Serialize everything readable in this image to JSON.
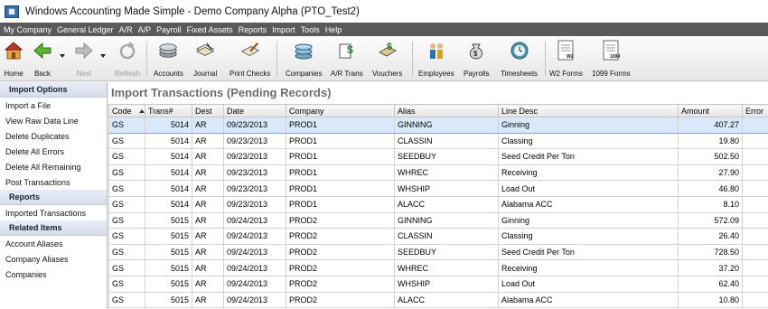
{
  "window": {
    "title": "Windows Accounting Made Simple - Demo Company Alpha (PTO_Test2)"
  },
  "menu": [
    "My Company",
    "General Ledger",
    "A/R",
    "A/P",
    "Payroll",
    "Fixed Assets",
    "Reports",
    "Import",
    "Tools",
    "Help"
  ],
  "toolbar": {
    "home": "Home",
    "back": "Back",
    "next": "Next",
    "refresh": "Refresh",
    "accounts": "Accounts",
    "journal": "Journal",
    "print_checks": "Print Checks",
    "companies": "Companies",
    "ar_trans": "A/R Trans",
    "vouchers": "Vouchers",
    "employees": "Employees",
    "payrolls": "Payrolls",
    "timesheets": "Timesheets",
    "w2_forms": "W2 Forms",
    "forms_1099": "1099 Forms",
    "w2_icon_text": "W2",
    "icon_1099_text": "1099"
  },
  "sidebar": {
    "import_options_header": "Import Options",
    "import_options": [
      "Import a File",
      "View Raw Data Line",
      "Delete Duplicates",
      "Delete All Errors",
      "Delete All Remaining",
      "Post Transactions"
    ],
    "reports_header": "Reports",
    "reports": [
      "Imported Transactions"
    ],
    "related_header": "Related Items",
    "related": [
      "Account Aliases",
      "Company Aliases",
      "Companies"
    ]
  },
  "main": {
    "title": "Import Transactions (Pending Records)",
    "columns": [
      "Code",
      "Trans#",
      "Dest",
      "Date",
      "Company",
      "Alias",
      "Line Desc",
      "Amount",
      "Error"
    ],
    "rows": [
      [
        "GS",
        "5014",
        "AR",
        "09/23/2013",
        "PROD1",
        "GINNING",
        "Ginning",
        "407.27",
        ""
      ],
      [
        "GS",
        "5014",
        "AR",
        "09/23/2013",
        "PROD1",
        "CLASSIN",
        "Classing",
        "19.80",
        ""
      ],
      [
        "GS",
        "5014",
        "AR",
        "09/23/2013",
        "PROD1",
        "SEEDBUY",
        "Seed Credit Per Ton",
        "502.50",
        ""
      ],
      [
        "GS",
        "5014",
        "AR",
        "09/23/2013",
        "PROD1",
        "WHREC",
        "Receiving",
        "27.90",
        ""
      ],
      [
        "GS",
        "5014",
        "AR",
        "09/23/2013",
        "PROD1",
        "WHSHIP",
        "Load Out",
        "46.80",
        ""
      ],
      [
        "GS",
        "5014",
        "AR",
        "09/23/2013",
        "PROD1",
        "ALACC",
        "Alabama ACC",
        "8.10",
        ""
      ],
      [
        "GS",
        "5015",
        "AR",
        "09/24/2013",
        "PROD2",
        "GINNING",
        "Ginning",
        "572.09",
        ""
      ],
      [
        "GS",
        "5015",
        "AR",
        "09/24/2013",
        "PROD2",
        "CLASSIN",
        "Classing",
        "26.40",
        ""
      ],
      [
        "GS",
        "5015",
        "AR",
        "09/24/2013",
        "PROD2",
        "SEEDBUY",
        "Seed Credit Per Ton",
        "728.50",
        ""
      ],
      [
        "GS",
        "5015",
        "AR",
        "09/24/2013",
        "PROD2",
        "WHREC",
        "Receiving",
        "37.20",
        ""
      ],
      [
        "GS",
        "5015",
        "AR",
        "09/24/2013",
        "PROD2",
        "WHSHIP",
        "Load Out",
        "62.40",
        ""
      ],
      [
        "GS",
        "5015",
        "AR",
        "09/24/2013",
        "PROD2",
        "ALACC",
        "Alabama ACC",
        "10.80",
        ""
      ]
    ],
    "selected_row": 0,
    "sorted_column": "Code"
  },
  "colors": {
    "menubar": "#5a5a5a",
    "selection": "#d9e8fb",
    "title_text": "#6e6e6e"
  }
}
